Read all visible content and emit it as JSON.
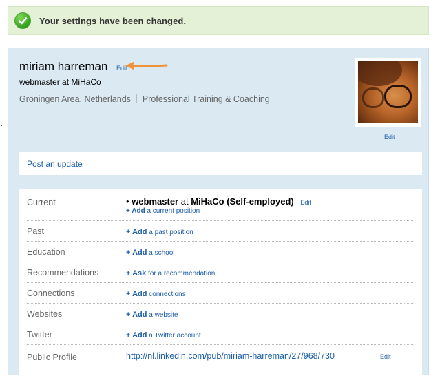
{
  "banner": {
    "message": "Your settings have been changed.",
    "icon": "check-circle-icon"
  },
  "profile": {
    "name": "miriam harreman",
    "name_edit": "Edit",
    "headline": "webmaster at MiHaCo",
    "location": "Groningen Area, Netherlands",
    "industry": "Professional Training & Coaching",
    "photo_edit": "Edit"
  },
  "update": {
    "label": "Post an update"
  },
  "details": {
    "current": {
      "label": "Current",
      "bullet": "•",
      "title": "webmaster",
      "at": "at",
      "company": "MiHaCo (Self-employed)",
      "edit": "Edit",
      "add_bold": "+ Add",
      "add_text": "a current position"
    },
    "rows": [
      {
        "label": "Past",
        "add_bold": "+ Add",
        "add_text": "a past position"
      },
      {
        "label": "Education",
        "add_bold": "+ Add",
        "add_text": "a school"
      },
      {
        "label": "Recommendations",
        "add_bold": "+ Ask",
        "add_text": "for a recommendation"
      },
      {
        "label": "Connections",
        "add_bold": "+ Add",
        "add_text": "connections"
      },
      {
        "label": "Websites",
        "add_bold": "+ Add",
        "add_text": "a website"
      },
      {
        "label": "Twitter",
        "add_bold": "+ Add",
        "add_text": "a Twitter account"
      }
    ],
    "public_profile": {
      "label": "Public Profile",
      "url": "http://nl.linkedin.com/pub/miriam-harreman/27/968/730",
      "edit": "Edit"
    }
  },
  "colors": {
    "link": "#1f5fa8",
    "banner_bg": "#e4f1d6",
    "panel_bg": "#dbe9f3",
    "arrow": "#f0923a"
  }
}
